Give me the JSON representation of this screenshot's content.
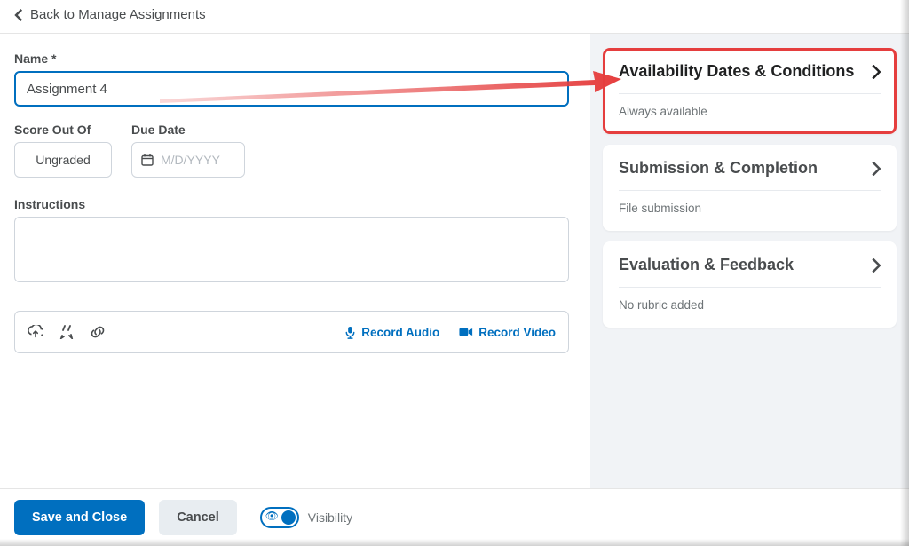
{
  "back_link": "Back to Manage Assignments",
  "name_label": "Name",
  "name_required": "*",
  "name_value": "Assignment 4",
  "score_label": "Score Out Of",
  "score_value": "Ungraded",
  "due_label": "Due Date",
  "due_placeholder": "M/D/YYYY",
  "instructions_label": "Instructions",
  "toolbar": {
    "record_audio": "Record Audio",
    "record_video": "Record Video"
  },
  "panels": {
    "availability": {
      "title": "Availability Dates & Conditions",
      "sub": "Always available"
    },
    "submission": {
      "title": "Submission & Completion",
      "sub": "File submission"
    },
    "evaluation": {
      "title": "Evaluation & Feedback",
      "sub": "No rubric added"
    }
  },
  "footer": {
    "save": "Save and Close",
    "cancel": "Cancel",
    "visibility": "Visibility"
  },
  "annotation": {
    "arrow_color": "#e53e3e",
    "callout_border": "#e53e3e"
  }
}
